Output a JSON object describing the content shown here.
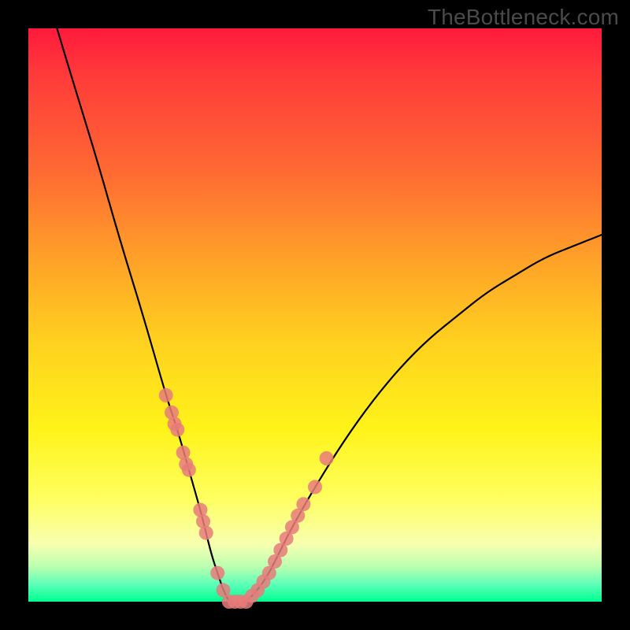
{
  "watermark": "TheBottleneck.com",
  "colors": {
    "gradient_top": "#ff1a3c",
    "gradient_mid1": "#ffa028",
    "gradient_mid2": "#fff31a",
    "gradient_bottom": "#00ff90",
    "curve": "#000000",
    "dots": "#e77b7b",
    "frame": "#000000"
  },
  "chart_data": {
    "type": "line",
    "title": "",
    "xlabel": "",
    "ylabel": "",
    "xlim": [
      0,
      100
    ],
    "ylim": [
      0,
      100
    ],
    "series": [
      {
        "name": "bottleneck-curve",
        "x": [
          5,
          8,
          12,
          16,
          20,
          24,
          26,
          28,
          30,
          31,
          32,
          33,
          34,
          35,
          36,
          38,
          40,
          42,
          44,
          46,
          50,
          55,
          60,
          65,
          70,
          75,
          80,
          85,
          90,
          95,
          100
        ],
        "y": [
          100,
          90,
          77,
          63,
          50,
          36,
          30,
          23,
          16,
          12,
          8,
          5,
          2,
          0,
          0,
          0,
          2,
          5,
          9,
          13,
          20,
          28,
          35,
          41,
          46,
          50,
          54,
          57,
          60,
          62,
          64
        ]
      }
    ],
    "markers": [
      {
        "name": "left-cluster",
        "x": [
          24,
          25,
          25.5,
          26,
          27,
          27.5,
          28,
          30,
          30.5,
          31
        ],
        "y": [
          36,
          33,
          31,
          30,
          26,
          24,
          23,
          16,
          14,
          12
        ]
      },
      {
        "name": "valley-floor",
        "x": [
          33,
          34,
          35,
          36,
          37,
          38
        ],
        "y": [
          5,
          2,
          0,
          0,
          0,
          0
        ]
      },
      {
        "name": "right-cluster",
        "x": [
          39,
          40,
          41,
          42,
          43,
          44,
          45,
          46,
          47,
          48,
          50,
          52
        ],
        "y": [
          1,
          2,
          3.5,
          5,
          7,
          9,
          11,
          13,
          15,
          17,
          20,
          25
        ]
      }
    ]
  }
}
